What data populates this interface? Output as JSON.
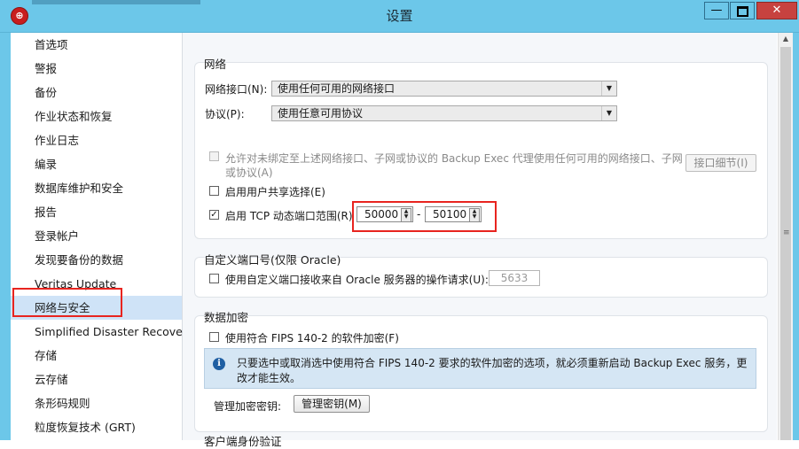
{
  "window": {
    "title": "设置",
    "min_label": "—",
    "close_label": "✕",
    "app_icon": "backup-exec-icon"
  },
  "sidebar": {
    "items": [
      {
        "label": "首选项"
      },
      {
        "label": "警报"
      },
      {
        "label": "备份"
      },
      {
        "label": "作业状态和恢复"
      },
      {
        "label": "作业日志"
      },
      {
        "label": "编录"
      },
      {
        "label": "数据库维护和安全"
      },
      {
        "label": "报告"
      },
      {
        "label": "登录帐户"
      },
      {
        "label": "发现要备份的数据"
      },
      {
        "label": "Veritas Update"
      },
      {
        "label": "网络与安全",
        "selected": true
      },
      {
        "label": "Simplified Disaster Recovery"
      },
      {
        "label": "存储"
      },
      {
        "label": "云存储"
      },
      {
        "label": "条形码规则"
      },
      {
        "label": "粒度恢复技术 (GRT)"
      }
    ]
  },
  "network": {
    "title": "网络",
    "interface_label": "网络接口(N):",
    "interface_value": "使用任何可用的网络接口",
    "protocol_label": "协议(P):",
    "protocol_value": "使用任意可用协议",
    "allow_agent_label_line1": "允许对未绑定至上述网络接口、子网或协议的 Backup Exec 代理使用任何可用的网络接口、子网",
    "allow_agent_label_line2": "或协议(A)",
    "interface_details_button": "接口细节(I)",
    "user_share_label": "启用用户共享选择(E)",
    "tcp_range_label": "启用 TCP 动态端口范围(R)",
    "tcp_range_from": "50000",
    "tcp_range_to": "50100",
    "range_separator": "-"
  },
  "custom_port": {
    "title": "自定义端口号(仅限 Oracle)",
    "label": "使用自定义端口接收来自 Oracle 服务器的操作请求(U):",
    "value": "5633"
  },
  "encryption": {
    "title": "数据加密",
    "fips_label": "使用符合 FIPS 140-2 的软件加密(F)",
    "info_text": "只要选中或取消选中使用符合 FIPS 140-2 要求的软件加密的选项，就必须重新启动 Backup Exec 服务，更改才能生效。",
    "manage_key_label": "管理加密密钥:",
    "manage_key_button": "管理密钥(M)"
  },
  "next_section": {
    "title": "客户端身份验证"
  }
}
